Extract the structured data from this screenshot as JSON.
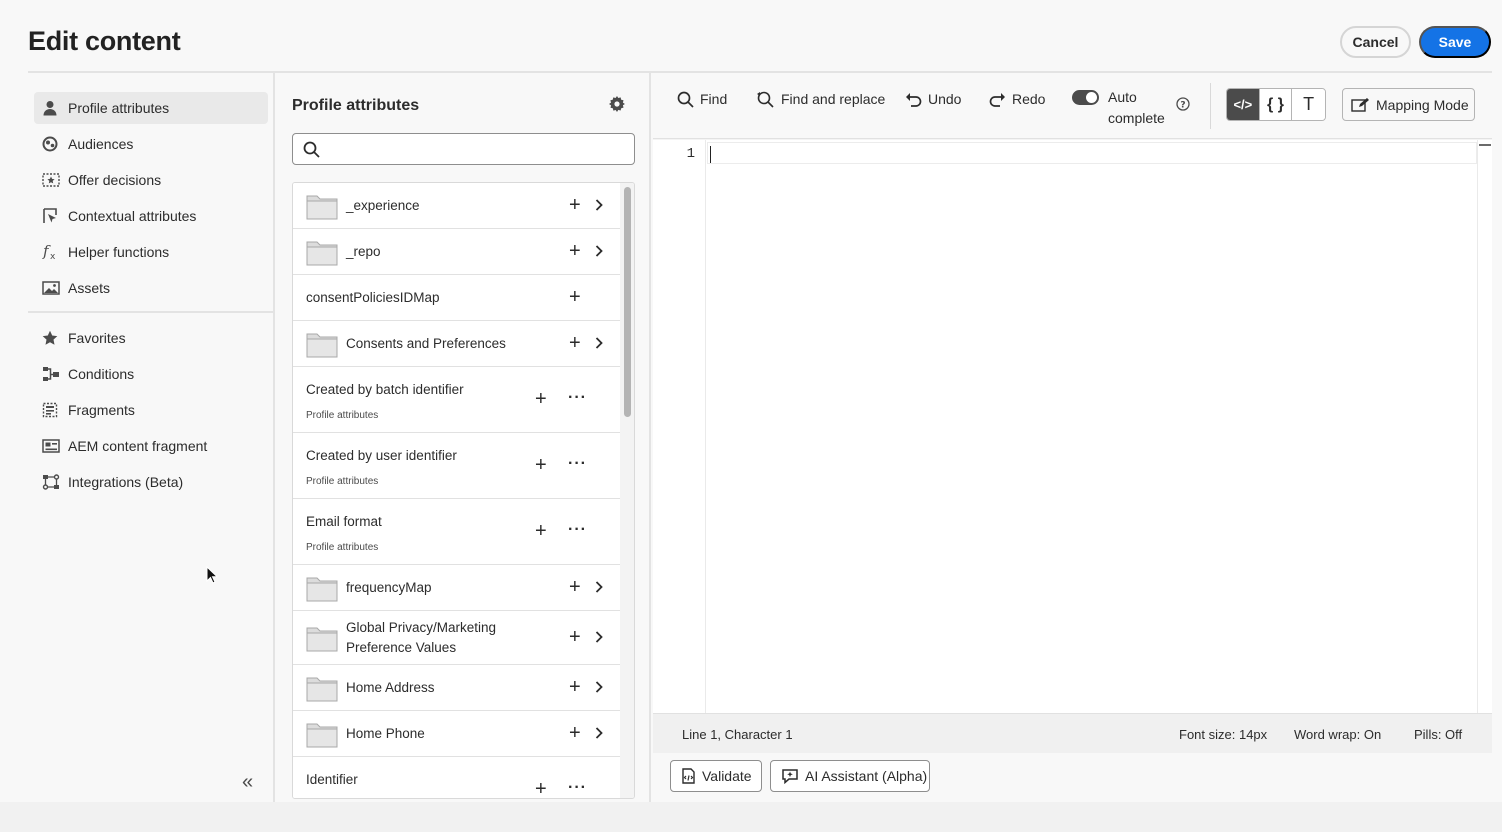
{
  "header": {
    "title": "Edit content",
    "cancel_label": "Cancel",
    "save_label": "Save"
  },
  "nav": {
    "items": [
      {
        "label": "Profile attributes",
        "icon": "person-icon"
      },
      {
        "label": "Audiences",
        "icon": "audiences-icon"
      },
      {
        "label": "Offer decisions",
        "icon": "offer-icon"
      },
      {
        "label": "Contextual attributes",
        "icon": "contextual-icon"
      },
      {
        "label": "Helper functions",
        "icon": "function-icon"
      },
      {
        "label": "Assets",
        "icon": "image-icon"
      },
      {
        "label": "Favorites",
        "icon": "star-icon"
      },
      {
        "label": "Conditions",
        "icon": "branch-icon"
      },
      {
        "label": "Fragments",
        "icon": "fragment-icon"
      },
      {
        "label": "AEM content fragment",
        "icon": "aem-fragment-icon"
      },
      {
        "label": "Integrations (Beta)",
        "icon": "integrations-icon"
      }
    ],
    "collapse_glyph": "«"
  },
  "panel": {
    "title": "Profile attributes",
    "search_placeholder": "",
    "rows": [
      {
        "label": "_experience"
      },
      {
        "label": "_repo"
      },
      {
        "label": "consentPoliciesIDMap"
      },
      {
        "label": "Consents and Preferences"
      },
      {
        "label": "Created by batch identifier",
        "sub": "Profile attributes"
      },
      {
        "label": "Created by user identifier",
        "sub": "Profile attributes"
      },
      {
        "label": "Email format",
        "sub": "Profile attributes"
      },
      {
        "label": "frequencyMap"
      },
      {
        "label": "Global Privacy/Marketing Preference Values"
      },
      {
        "label": "Home Address"
      },
      {
        "label": "Home Phone"
      },
      {
        "label": "Identifier"
      }
    ]
  },
  "toolbar": {
    "find": "Find",
    "find_replace": "Find and replace",
    "undo": "Undo",
    "redo": "Redo",
    "autocomplete_line1": "Auto",
    "autocomplete_line2": "complete",
    "autocomplete_on": true,
    "mode_code": "</>",
    "mode_json": "{ }",
    "mode_text": "T",
    "mapping_mode": "Mapping Mode"
  },
  "editor": {
    "line_number": "1"
  },
  "status": {
    "position": "Line 1, Character 1",
    "font_size": "Font size: 14px",
    "word_wrap": "Word wrap: On",
    "pills": "Pills: Off"
  },
  "footer": {
    "validate": "Validate",
    "ai_assistant": "AI Assistant (Alpha)"
  },
  "colors": {
    "primary": "#1473e6",
    "selected_nav": "#e9e9e9",
    "toggle_on": "#4b4b4b"
  }
}
